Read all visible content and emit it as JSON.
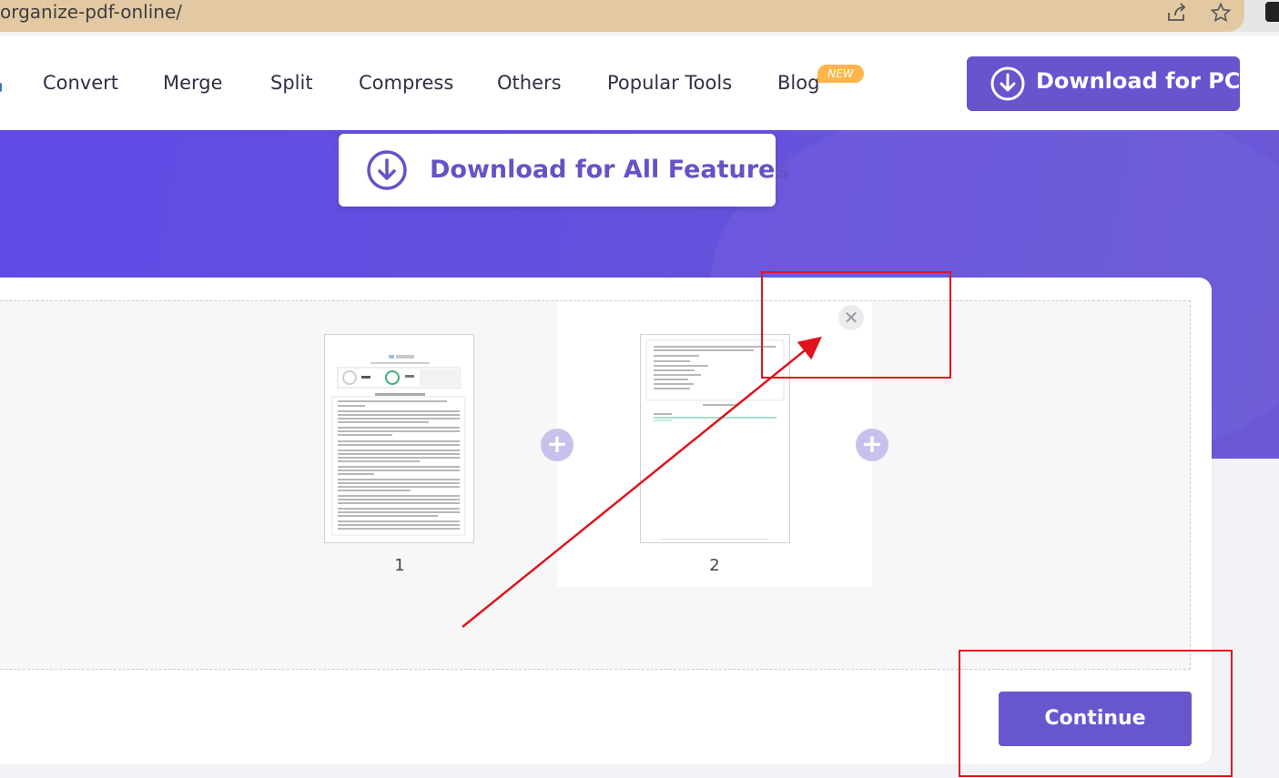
{
  "browser": {
    "url": "organize-pdf-online/",
    "icons": [
      "share-icon",
      "star-icon",
      "extension-icon"
    ]
  },
  "nav": {
    "items": [
      "Convert",
      "Merge",
      "Split",
      "Compress",
      "Others",
      "Popular Tools",
      "Blog"
    ],
    "badge": "NEW",
    "download_pc": "Download for PC"
  },
  "hero": {
    "download_all": "Download for All Features"
  },
  "pages": [
    {
      "number": "1"
    },
    {
      "number": "2"
    }
  ],
  "actions": {
    "continue": "Continue"
  },
  "colors": {
    "brand": "#6655cc",
    "annotation": "#e0141e"
  }
}
